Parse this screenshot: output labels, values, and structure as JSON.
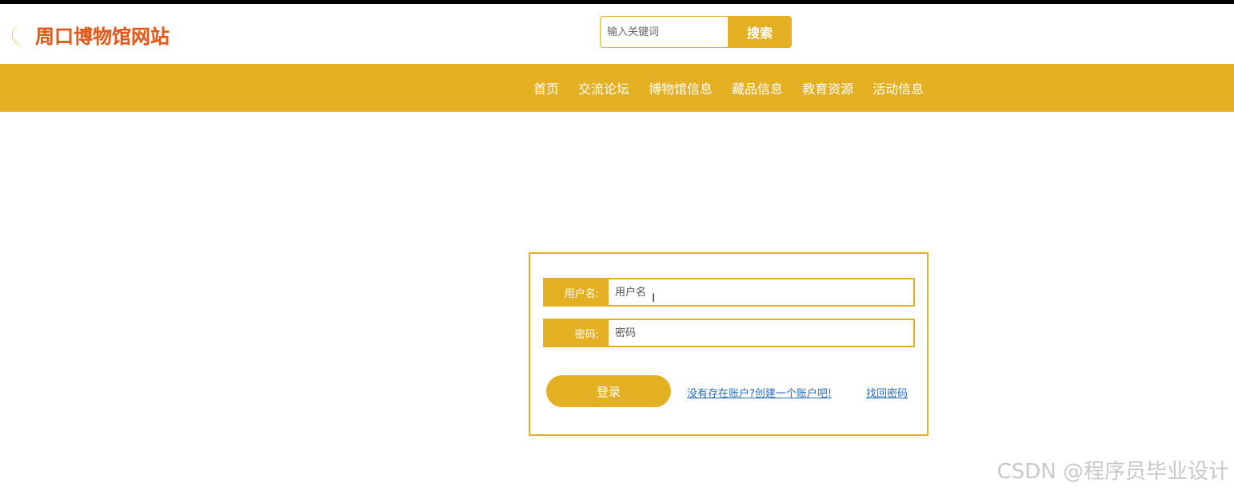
{
  "site": {
    "title": "周口博物馆网站",
    "brand_color": "#e3b024",
    "logo_icon": "crescent-moon-icon"
  },
  "search": {
    "placeholder": "输入关键词",
    "button_label": "搜索"
  },
  "nav": {
    "items": [
      "首页",
      "交流论坛",
      "博物馆信息",
      "藏品信息",
      "教育资源",
      "活动信息"
    ]
  },
  "login": {
    "username_label": "用户名:",
    "username_placeholder": "用户名",
    "password_label": "密码:",
    "password_placeholder": "密码",
    "submit_label": "登录",
    "register_link": "没有存在账户?创建一个账户吧!",
    "forgot_link": "找回密码"
  },
  "watermark": "CSDN @程序员毕业设计"
}
